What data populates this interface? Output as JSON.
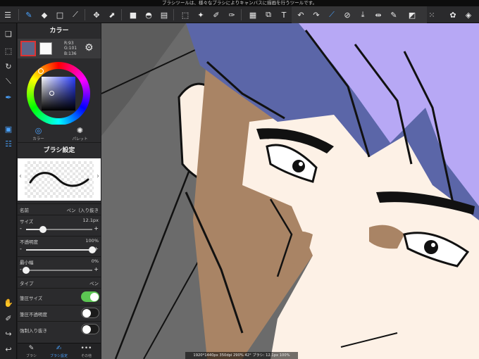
{
  "hint": "ブラシツールは、様々なブラシによりキャンバスに描画を行うツールです。",
  "color_panel": {
    "title": "カラー",
    "main_color": "#5D6588",
    "rgb": {
      "r": "R:93",
      "g": "G:101",
      "b": "B:136"
    },
    "tabs": [
      {
        "label": "カラー"
      },
      {
        "label": "パレット"
      }
    ]
  },
  "brush_panel": {
    "title": "ブラシ設定",
    "name_label": "名前",
    "name_value": "ペン（入り抜き",
    "size_label": "サイズ",
    "size_value": "12.1px",
    "size_level": 0.25,
    "opacity_label": "不透明度",
    "opacity_value": "100%",
    "opacity_level": 1.0,
    "min_width_label": "最小幅",
    "min_width_value": "0%",
    "min_width_level": 0.0,
    "type_label": "タイプ",
    "type_value": "ペン",
    "toggles": [
      {
        "label": "筆圧サイズ",
        "on": true
      },
      {
        "label": "筆圧不透明度",
        "on": false
      },
      {
        "label": "強制入り抜き",
        "on": false
      }
    ]
  },
  "bottom_tabs": [
    {
      "label": "ブラシ"
    },
    {
      "label": "ブラシ設定"
    },
    {
      "label": "その他"
    }
  ],
  "status": "1920*1440px 350dpi 290% 42° ブラシ: 12.1px 100%",
  "colors": {
    "accent": "#4AA3FF",
    "toggle_on": "#5CC653",
    "hair": "#B7A8F5",
    "hair_shadow": "#5B66A8",
    "skin": "#FCF0E4",
    "skin_shadow": "#A88366"
  }
}
